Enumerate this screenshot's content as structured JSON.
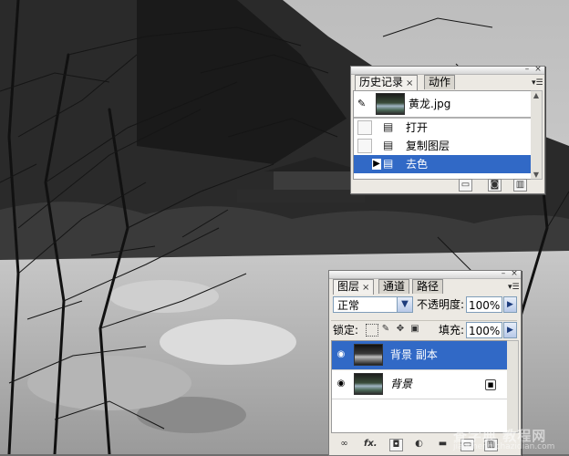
{
  "history_panel": {
    "tabs": [
      {
        "label": "历史记录",
        "active": true,
        "closable": true
      },
      {
        "label": "动作",
        "active": false,
        "closable": false
      }
    ],
    "snapshot": {
      "name": "黄龙.jpg",
      "icon": "photo-thumbnail"
    },
    "steps": [
      {
        "label": "打开",
        "selected": false
      },
      {
        "label": "复制图层",
        "selected": false
      },
      {
        "label": "去色",
        "selected": true
      }
    ],
    "bottom_icons": [
      "new-document-from-state-icon",
      "camera-snapshot-icon",
      "trash-icon"
    ]
  },
  "layers_panel": {
    "tabs": [
      {
        "label": "图层",
        "active": true,
        "closable": true
      },
      {
        "label": "通道",
        "active": false,
        "closable": false
      },
      {
        "label": "路径",
        "active": false,
        "closable": false
      }
    ],
    "blend_mode": "正常",
    "opacity_label": "不透明度:",
    "opacity_value": "100%",
    "lock_label": "锁定:",
    "fill_label": "填充:",
    "fill_value": "100%",
    "layers": [
      {
        "name": "背景 副本",
        "selected": true,
        "visible": true,
        "locked": false
      },
      {
        "name": "背景",
        "selected": false,
        "visible": true,
        "locked": true
      }
    ],
    "bottom_icons": [
      "link-icon",
      "fx-icon",
      "mask-icon",
      "adjustment-icon",
      "group-folder-icon",
      "new-layer-icon",
      "trash-icon"
    ],
    "fx_label": "fx."
  },
  "watermark": {
    "text": "查字典 教程网",
    "url": "jiaocheng.chazidian.com"
  },
  "colors": {
    "selection": "#3169c6",
    "panel_bg": "#ece9e3"
  }
}
